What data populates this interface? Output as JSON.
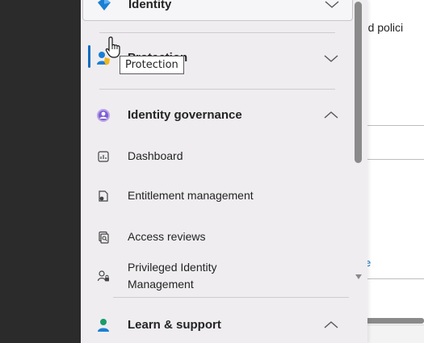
{
  "background_page": {
    "heading_fragment": "ged polici",
    "link_fragment": "e"
  },
  "nav": {
    "top_group": {
      "label": "Identity",
      "icon": "identity-diamond-icon"
    },
    "protection": {
      "label": "Protection",
      "icon": "protection-shield-icon"
    },
    "identity_governance": {
      "label": "Identity governance",
      "icon": "identity-governance-icon",
      "items": [
        {
          "label": "Dashboard",
          "icon": "dashboard-icon"
        },
        {
          "label": "Entitlement management",
          "icon": "entitlement-icon"
        },
        {
          "label": "Access reviews",
          "icon": "access-reviews-icon"
        },
        {
          "label": "Privileged Identity Management",
          "line1": "Privileged Identity",
          "line2": "Management",
          "icon": "pim-icon"
        }
      ]
    },
    "learn_support": {
      "label": "Learn & support",
      "icon": "learn-support-icon"
    }
  },
  "tooltip": {
    "text": "Protection"
  },
  "colors": {
    "accent": "#0f6cbd",
    "panel_bg": "#efedf0"
  }
}
